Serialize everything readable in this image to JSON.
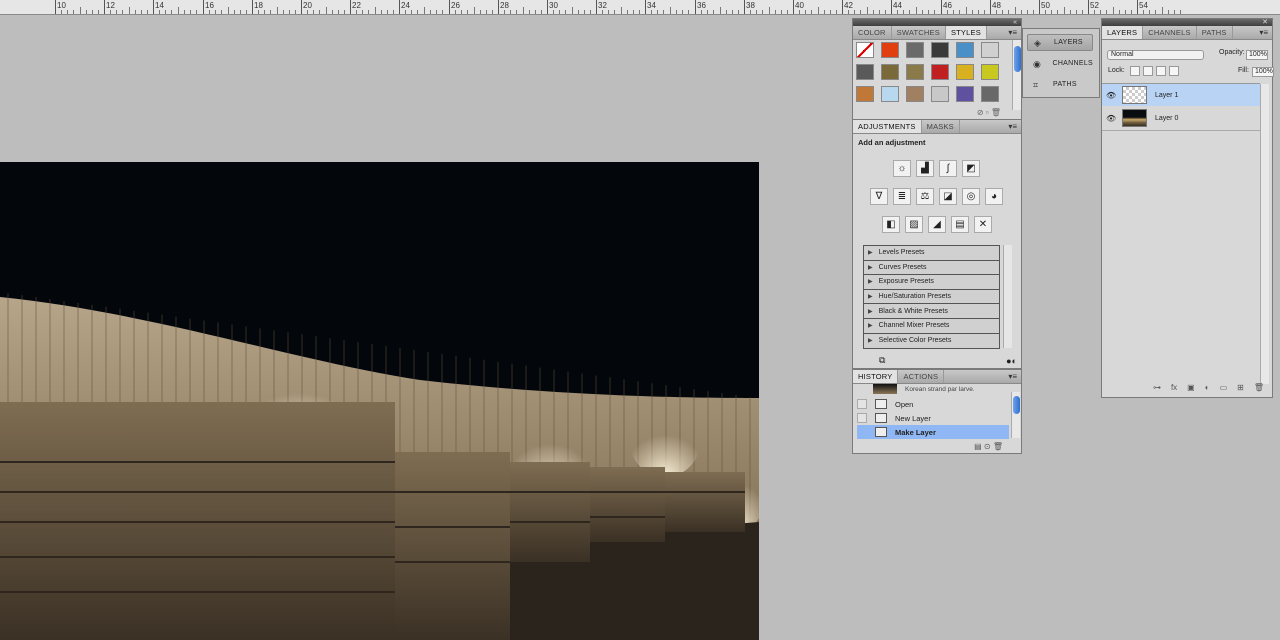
{
  "ruler": {
    "labels": [
      "10",
      "12",
      "14",
      "16",
      "18",
      "20",
      "22",
      "24",
      "26",
      "28",
      "30",
      "32",
      "34",
      "36",
      "38",
      "40",
      "42",
      "44",
      "46",
      "48",
      "50",
      "52",
      "54"
    ]
  },
  "styles_panel": {
    "tabs": [
      "COLOR",
      "SWATCHES",
      "STYLES"
    ],
    "active_tab": "STYLES",
    "swatch_colors": [
      "#f4f4f4",
      "#e04010",
      "#6a6a6a",
      "#3a3a3a",
      "#4a90c8",
      "#d0d0d0",
      "#5a5a5a",
      "#7a6a3a",
      "#8a7a4a",
      "#c02020",
      "#d8b020",
      "#c8c820",
      "#c07838",
      "#b8d8f0",
      "#a08060",
      "#c8c8c8",
      "#6050a0",
      "#686868"
    ]
  },
  "dock": {
    "items": [
      {
        "label": "LAYERS",
        "icon": "layers-icon"
      },
      {
        "label": "CHANNELS",
        "icon": "channels-icon"
      },
      {
        "label": "PATHS",
        "icon": "paths-icon"
      }
    ]
  },
  "adjustments_panel": {
    "tabs": [
      "ADJUSTMENTS",
      "MASKS"
    ],
    "title": "Add an adjustment",
    "presets": [
      "Levels Presets",
      "Curves Presets",
      "Exposure Presets",
      "Hue/Saturation Presets",
      "Black & White Presets",
      "Channel Mixer Presets",
      "Selective Color Presets"
    ]
  },
  "history_panel": {
    "tabs": [
      "HISTORY",
      "ACTIONS"
    ],
    "snapshot": "Korean strand par larve.",
    "states": [
      "Open",
      "New Layer",
      "Make Layer"
    ],
    "selected": "Make Layer"
  },
  "layers_panel": {
    "tabs": [
      "LAYERS",
      "CHANNELS",
      "PATHS"
    ],
    "blend_mode": "Normal",
    "opacity_label": "Opacity:",
    "opacity_value": "100%",
    "lock_label": "Lock:",
    "fill_label": "Fill:",
    "fill_value": "100%",
    "layers": [
      {
        "name": "Layer 1",
        "selected": true
      },
      {
        "name": "Layer 0",
        "selected": false
      }
    ]
  }
}
